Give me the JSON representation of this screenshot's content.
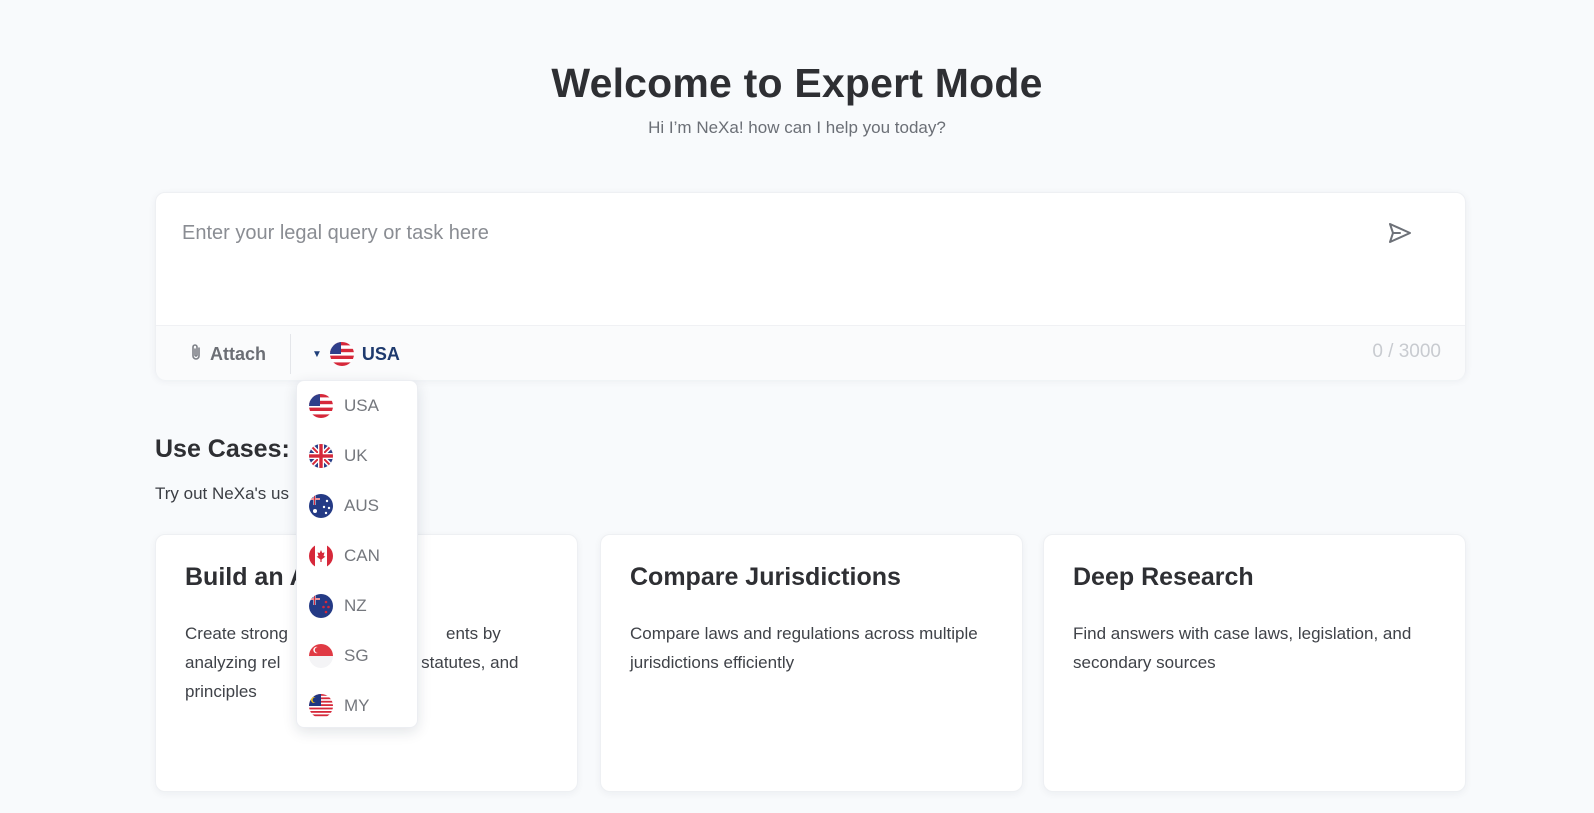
{
  "hero": {
    "title": "Welcome to Expert Mode",
    "subtitle": "Hi I’m NeXa! how can I help you today?"
  },
  "query": {
    "placeholder": "Enter your legal query or task here",
    "value": "",
    "send_icon": "send-icon",
    "attach_label": "Attach",
    "attach_icon": "paperclip-icon",
    "selected_country": "USA",
    "char_count": "0 / 3000"
  },
  "countries": [
    {
      "code": "USA",
      "flag": "flag-us"
    },
    {
      "code": "UK",
      "flag": "flag-uk"
    },
    {
      "code": "AUS",
      "flag": "flag-aus"
    },
    {
      "code": "CAN",
      "flag": "flag-can"
    },
    {
      "code": "NZ",
      "flag": "flag-nz"
    },
    {
      "code": "SG",
      "flag": "flag-sg"
    },
    {
      "code": "MY",
      "flag": "flag-my"
    }
  ],
  "use_cases": {
    "title": "Use Cases:",
    "subtitle": "Try out NeXa's us",
    "cards": [
      {
        "title": "Build an A",
        "description_lines": [
          "Create strong",
          "ents by",
          "analyzing rel",
          "y, statutes, and",
          "principles"
        ]
      },
      {
        "title": "Compare Jurisdictions",
        "description": "Compare laws and regulations across multiple jurisdictions efficiently"
      },
      {
        "title": "Deep Research",
        "description": "Find answers with case laws, legislation, and secondary sources"
      }
    ]
  },
  "colors": {
    "background": "#f8fafc",
    "accent": "#1e3a6e",
    "muted": "#8a8d93"
  }
}
